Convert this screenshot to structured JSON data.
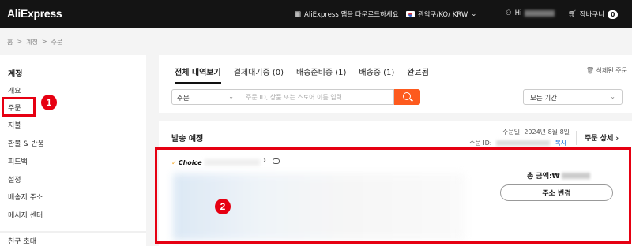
{
  "header": {
    "logo": "AliExpress",
    "app_download": "AliExpress 앱을 다운로드하세요",
    "region": "관악구/KO/ KRW",
    "user": "Hi",
    "cart_label": "장바구니",
    "cart_count": "0"
  },
  "breadcrumb": [
    "홈",
    ">",
    "계정",
    ">",
    "주문"
  ],
  "sidebar": {
    "title": "계정",
    "items": [
      "개요",
      "주문",
      "지불",
      "환불 & 반품",
      "피드백",
      "설정",
      "배송지 주소",
      "메시지 센터",
      "친구 초대"
    ]
  },
  "tabs": [
    "전체 내역보기",
    "결제대기중 (0)",
    "배송준비중 (1)",
    "배송중 (1)",
    "완료됨"
  ],
  "deleted_orders": "삭제된 주문",
  "filter": {
    "type_value": "주문",
    "search_placeholder": "주문 ID, 상품 또는 스토어 이름 입력",
    "period_value": "모든 기간"
  },
  "order": {
    "status": "발송 예정",
    "date": "주문일: 2024년 8월 8일",
    "id_label": "주문 ID:",
    "copy": "복사",
    "detail": "주문 상세",
    "choice_label": "Choice",
    "total_label": "총 금액:₩",
    "address_button": "주소 변경"
  },
  "annotations": [
    "1",
    "2"
  ],
  "colors": {
    "accent": "#fd5a1e",
    "highlight": "#e60012",
    "header_bg": "#141414"
  }
}
